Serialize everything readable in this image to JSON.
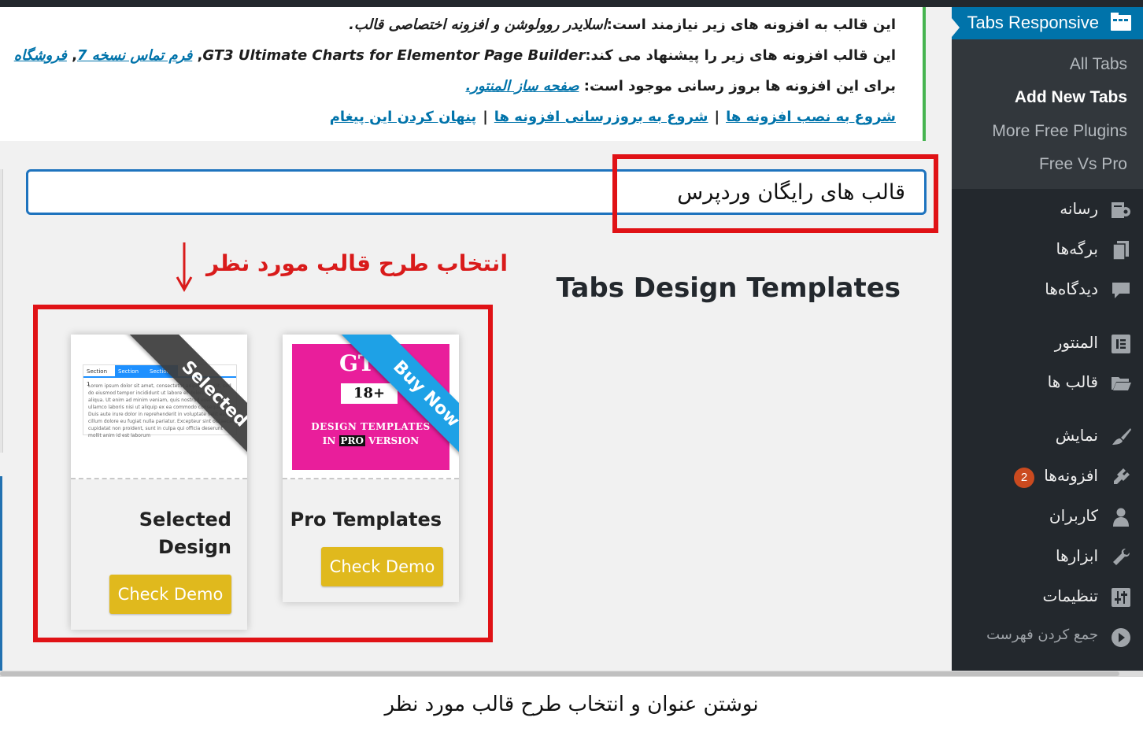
{
  "notice": {
    "line1_text": "این قالب به افزونه های زیر نیازمند است:",
    "line1_plugins": "اسلایدر روولوشن و افزونه اختصاصی قالب.",
    "line2_text": "این قالب افزونه های زیر را پیشنهاد می کند:",
    "line2_plugin1": "GT3 Ultimate Charts for Elementor Page Builder",
    "line2_comma1": ",",
    "line2_link1": "فرم تماس نسخه 7",
    "line2_comma2": ",",
    "line2_link2": "فروشگاه",
    "line3_text": "برای این افزونه ها بروز رسانی موجود است:",
    "line3_link": "صفحه ساز المنتور.",
    "link_install": "شروع به نصب افزونه ها",
    "link_update": "شروع به بروزرسانی افزونه ها",
    "link_dismiss": "پنهان کردن این پیغام",
    "separator": "|"
  },
  "title_input": {
    "value": "قالب های رایگان وردپرس"
  },
  "annotation": {
    "label": "انتخاب طرح قالب مورد نظر",
    "color": "#e01216"
  },
  "templates": {
    "heading": "Tabs Design Templates",
    "cards": [
      {
        "title": "Selected Design",
        "ribbon": "Selected",
        "button": "Check Demo",
        "preview": {
          "tabs": [
            "Section 1",
            "Section 2",
            "Section 3"
          ],
          "body": "Lorem ipsum dolor sit amet, consectetur adipisicing elit, sed do eiusmod tempor incididunt ut labore et dolore magna aliqua. Ut enim ad minim veniam, quis nostrud exercitation ullamco laboris nisi ut aliquip ex ea commodo consequat. Duis aute irure dolor in reprehenderit in voluptate velit esse cillum dolore eu fugiat nulla pariatur. Excepteur sint occaecat cupidatat non proident, sunt in culpa qui officia deserunt mollit anim id est laborum"
        }
      },
      {
        "title": "Pro Templates",
        "ribbon": "Buy Now",
        "button": "Check Demo",
        "preview": {
          "brand": "GT",
          "count": "18+",
          "line1": "DESIGN TEMPLATES",
          "line2_pre": "IN ",
          "line2_badge": "PRO",
          "line2_post": " VERSION"
        }
      }
    ],
    "button_color": "#e0b91d",
    "pro_image_color": "#e91e9b",
    "ribbon_selected_color": "#3d3d3d",
    "ribbon_buynow_color": "#1ea1e6"
  },
  "sidebar": {
    "active": {
      "label": "Tabs Responsive",
      "icon": "folder-tabs-icon"
    },
    "submenu": [
      {
        "label": "All Tabs",
        "current": false
      },
      {
        "label": "Add New Tabs",
        "current": true
      },
      {
        "label": "More Free Plugins",
        "current": false
      },
      {
        "label": "Free Vs Pro",
        "current": false
      }
    ],
    "menu": [
      {
        "label": "رسانه",
        "icon": "media-icon"
      },
      {
        "label": "برگه‌ها",
        "icon": "pages-icon"
      },
      {
        "label": "دیدگاه‌ها",
        "icon": "comments-icon"
      },
      {
        "label": "المنتور",
        "icon": "elementor-icon"
      },
      {
        "label": "قالب ها",
        "icon": "folder-icon"
      },
      {
        "label": "نمایش",
        "icon": "appearance-brush-icon"
      },
      {
        "label": "افزونه‌ها",
        "icon": "plugins-icon",
        "badge": "2"
      },
      {
        "label": "کاربران",
        "icon": "users-icon"
      },
      {
        "label": "ابزارها",
        "icon": "tools-wrench-icon"
      },
      {
        "label": "تنظیمات",
        "icon": "settings-sliders-icon"
      },
      {
        "label": "جمع کردن فهرست",
        "icon": "collapse-play-icon"
      }
    ],
    "bg_color": "#23282d",
    "active_color": "#0073aa",
    "badge_color": "#ca4a1f"
  },
  "caption": "نوشتن عنوان و انتخاب طرح قالب مورد نظر"
}
